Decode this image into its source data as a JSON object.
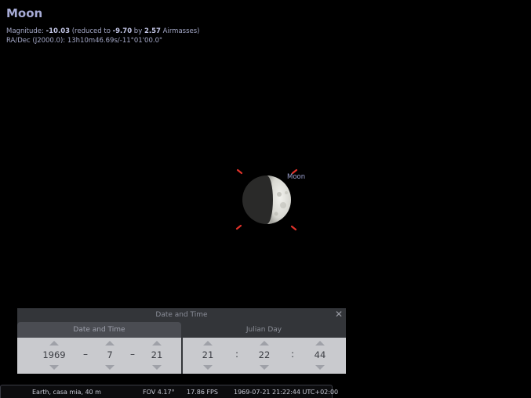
{
  "object": {
    "name": "Moon",
    "magnitude_label": "Magnitude: ",
    "magnitude": "-10.03",
    "reduced_prefix": " (reduced to ",
    "reduced_value": "-9.70",
    "by_text": " by ",
    "airmass": "2.57",
    "airmass_suffix": " Airmasses)",
    "radec": "RA/Dec (J2000.0): 13h10m46.69s/-11°01'00.0\"",
    "sky_label": "Moon"
  },
  "dialog": {
    "title": "Date and Time",
    "close_icon": "close-icon",
    "tab_date": "Date and Time",
    "tab_julian": "Julian Day",
    "year": "1969",
    "month": "7",
    "day": "21",
    "date_sep": "–",
    "hour": "21",
    "minute": "22",
    "second": "44",
    "time_sep": ":"
  },
  "statusbar": {
    "location": "Earth, casa mia, 40 m",
    "fov": "FOV 4.17°",
    "fps": "17.86 FPS",
    "datetime": "1969-07-21 21:22:44 UTC+02:00"
  },
  "colors": {
    "marker": "#e0322a",
    "background": "#000000"
  }
}
